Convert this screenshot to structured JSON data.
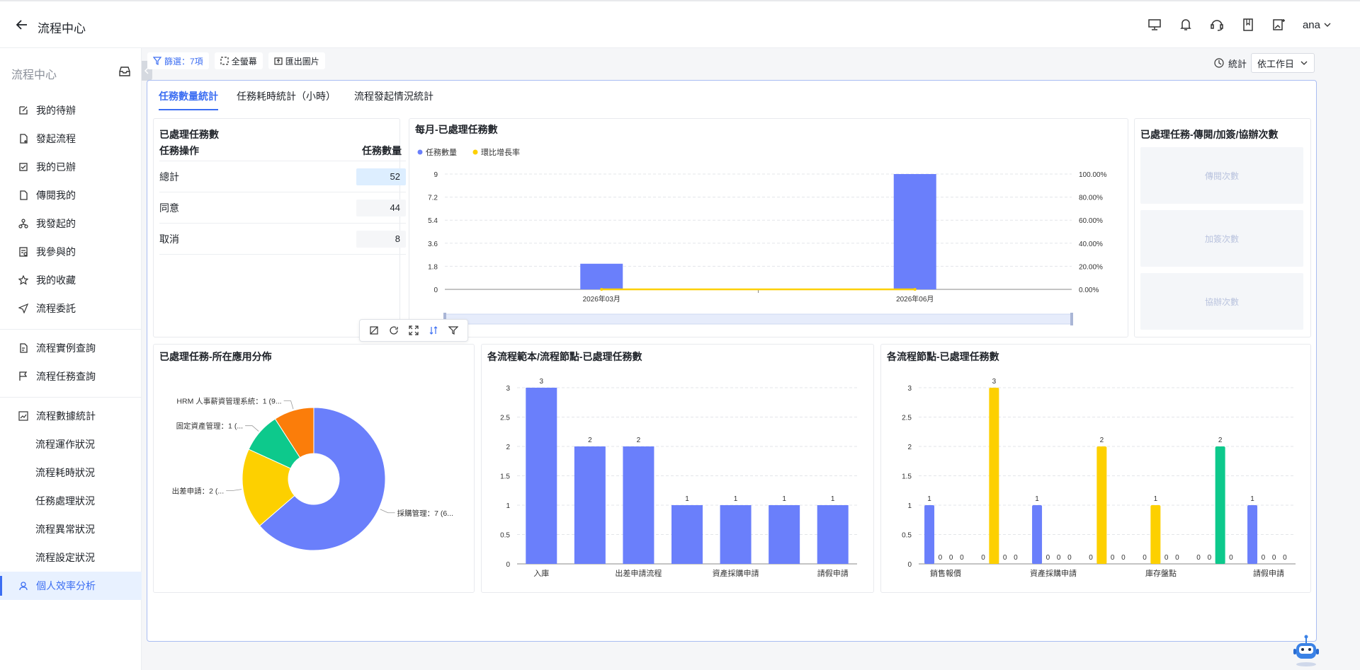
{
  "app": {
    "title": "流程中心",
    "user": "ana"
  },
  "sidebar": {
    "header": "流程中心",
    "items": [
      {
        "label": "我的待辦",
        "icon": "edit-icon"
      },
      {
        "label": "發起流程",
        "icon": "file-add-icon"
      },
      {
        "label": "我的已辦",
        "icon": "checked-icon"
      },
      {
        "label": "傳閱我的",
        "icon": "file-icon"
      },
      {
        "label": "我發起的",
        "icon": "org-icon"
      },
      {
        "label": "我參與的",
        "icon": "doc-check-icon"
      },
      {
        "label": "我的收藏",
        "icon": "star-icon"
      },
      {
        "label": "流程委託",
        "icon": "send-icon"
      },
      {
        "label": "流程實例查詢",
        "icon": "file-search-icon"
      },
      {
        "label": "流程任務查詢",
        "icon": "flag-icon"
      },
      {
        "label": "流程數據統計",
        "icon": "line-chart-icon"
      },
      {
        "label": "流程運作狀況"
      },
      {
        "label": "流程耗時狀況"
      },
      {
        "label": "任務處理狀況"
      },
      {
        "label": "流程異常狀況"
      },
      {
        "label": "流程設定狀況"
      },
      {
        "label": "個人效率分析",
        "icon": "user-icon"
      }
    ]
  },
  "toolbar": {
    "filter": "篩選：7項",
    "fullscreen": "全螢幕",
    "export": "匯出圖片"
  },
  "stat": {
    "label": "統計",
    "select": "依工作日"
  },
  "tabs": [
    "任務數量統計",
    "任務耗時統計（小時）",
    "流程發起情況統計"
  ],
  "table_card": {
    "title": "已處理任務數",
    "col1": "任務操作",
    "col2": "任務數量",
    "rows": [
      {
        "label": "總計",
        "value": "52"
      },
      {
        "label": "同意",
        "value": "44"
      },
      {
        "label": "取消",
        "value": "8"
      }
    ]
  },
  "right_card": {
    "title": "已處理任務-傳閱/加簽/協辦次數",
    "boxes": [
      "傳閱次數",
      "加簽次數",
      "協辦次數"
    ]
  },
  "colors": {
    "blue": "#6a7ffb",
    "yellow": "#fdd000",
    "green": "#0dc98c",
    "orange": "#fb7d0a",
    "accent": "#3c6ef2"
  },
  "chart_data": [
    {
      "type": "bar",
      "title": "每月-已處理任務數",
      "categories": [
        "2026年03月",
        "2026年06月"
      ],
      "series": [
        {
          "name": "任務數量",
          "values": [
            2,
            9
          ]
        },
        {
          "name": "環比增長率",
          "type": "line",
          "values": [
            0,
            0
          ]
        }
      ],
      "ylim": [
        0,
        9
      ],
      "yticks": [
        "0",
        "1.8",
        "3.6",
        "5.4",
        "7.2",
        "9"
      ],
      "y2ticks": [
        "0.00%",
        "20.00%",
        "40.00%",
        "60.00%",
        "80.00%",
        "100.00%"
      ],
      "legend": "top-left",
      "grid": true
    },
    {
      "type": "pie",
      "title": "已處理任務-所在應用分佈",
      "slices": [
        {
          "label": "採購管理：7 (6...",
          "value": 7
        },
        {
          "label": "出差申請：2 (...",
          "value": 2
        },
        {
          "label": "固定資產管理：1 (...",
          "value": 1
        },
        {
          "label": "HRM 人事薪資管理系統：1 (9...",
          "value": 1
        }
      ]
    },
    {
      "type": "bar",
      "title": "各流程範本/流程節點-已處理任務數",
      "categories": [
        "入庫",
        "",
        "出差申請流程",
        "",
        "資產採購申請",
        "",
        "請假申請"
      ],
      "values": [
        3,
        2,
        2,
        1,
        1,
        1,
        1
      ],
      "yticks": [
        "0",
        "0.5",
        "1",
        "1.5",
        "2",
        "2.5",
        "3"
      ],
      "ylim": [
        0,
        3
      ],
      "grid": true
    },
    {
      "type": "bar",
      "title": "各流程節點-已處理任務數",
      "categories": [
        "銷售報價",
        "",
        "資產採購申請",
        "",
        "庫存盤點",
        "",
        "請假申請"
      ],
      "series": [
        {
          "values": [
            1,
            0,
            1,
            0,
            0,
            0,
            1
          ]
        },
        {
          "values": [
            0,
            3,
            0,
            2,
            1,
            0,
            0
          ]
        },
        {
          "values": [
            0,
            0,
            0,
            0,
            0,
            2,
            0
          ]
        },
        {
          "values": [
            0,
            0,
            0,
            0,
            0,
            0,
            0
          ]
        }
      ],
      "yticks": [
        "0",
        "0.5",
        "1",
        "1.5",
        "2",
        "2.5",
        "3"
      ],
      "ylim": [
        0,
        3
      ],
      "grid": true
    }
  ]
}
